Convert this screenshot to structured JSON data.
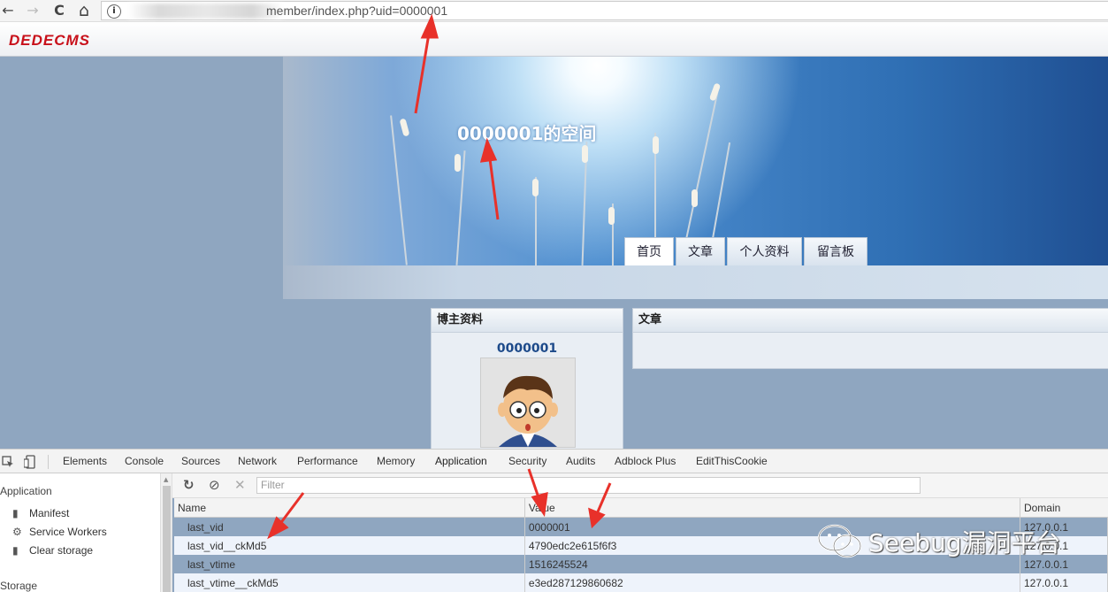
{
  "browser": {
    "back": "←",
    "forward": "→",
    "reload": "C",
    "home": "⌂",
    "info": "i",
    "url": "member/index.php?uid=0000001"
  },
  "site": {
    "logo": "DEDECMS",
    "space_title": "0000001的空间",
    "tabs": [
      "首页",
      "文章",
      "个人资料",
      "留言板"
    ],
    "active_tab": "首页",
    "profile_panel_title": "博主资料",
    "username": "0000001",
    "articles_panel_title": "文章"
  },
  "devtools": {
    "tabs": [
      "Elements",
      "Console",
      "Sources",
      "Network",
      "Performance",
      "Memory",
      "Application",
      "Security",
      "Audits",
      "Adblock Plus",
      "EditThisCookie"
    ],
    "active_tab": "Application",
    "sidebar": {
      "application_header": "Application",
      "items": [
        {
          "icon": "manifest-icon",
          "label": "Manifest"
        },
        {
          "icon": "gear-icon",
          "label": "Service Workers"
        },
        {
          "icon": "trash-icon",
          "label": "Clear storage"
        }
      ],
      "storage_header": "Storage"
    },
    "filter_placeholder": "Filter",
    "table": {
      "columns": [
        "Name",
        "Value",
        "Domain"
      ],
      "rows": [
        {
          "name": "last_vid",
          "value": "0000001",
          "domain": "127.0.0.1"
        },
        {
          "name": "last_vid__ckMd5",
          "value": "4790edc2e615f6f3",
          "domain": "127.0.0.1"
        },
        {
          "name": "last_vtime",
          "value": "1516245524",
          "domain": "127.0.0.1"
        },
        {
          "name": "last_vtime__ckMd5",
          "value": "e3ed287129860682",
          "domain": "127.0.0.1"
        }
      ]
    }
  },
  "watermark": {
    "text": "Seebug漏洞平台"
  },
  "colors": {
    "annotation_arrow": "#e8312a",
    "logo": "#c8101a",
    "active_tab_underline": "#3879d9"
  }
}
